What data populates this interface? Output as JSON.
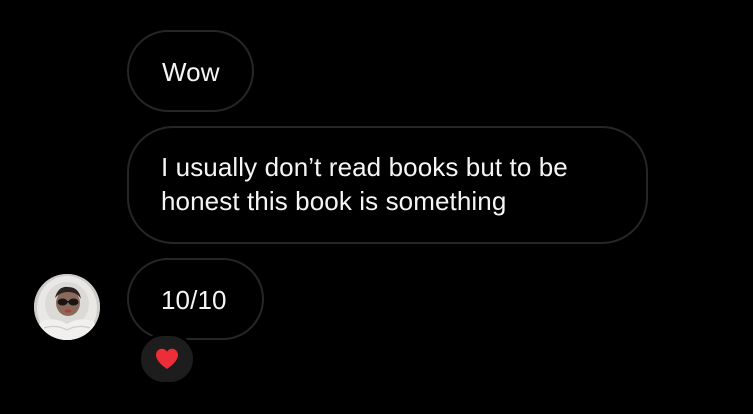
{
  "messages": [
    {
      "text": "Wow"
    },
    {
      "text": "I usually don’t read books but to be honest this book is something"
    },
    {
      "text": "10/10"
    }
  ],
  "sender": {
    "avatar_icon": "person-photo-avatar"
  },
  "reaction": {
    "icon": "heart-icon",
    "color": "#ed2d38"
  },
  "theme": {
    "background": "#000000",
    "bubble_border": "#262626",
    "text": "#f5f5f5",
    "reaction_background": "#1d1d1d"
  }
}
